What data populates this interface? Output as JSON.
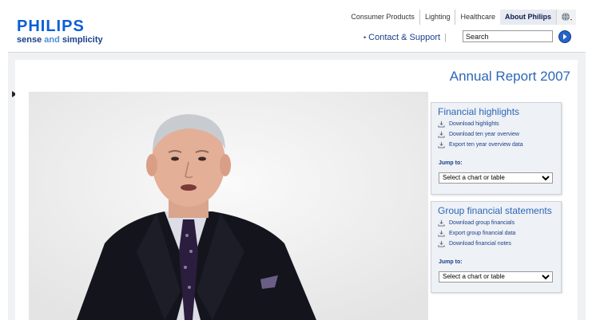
{
  "brand": {
    "logo": "PHILIPS",
    "tagline_a": "sense ",
    "tagline_and": "and",
    "tagline_b": " simplicity"
  },
  "topnav": {
    "tabs": [
      "Consumer Products",
      "Lighting",
      "Healthcare",
      "About Philips"
    ],
    "active": "About Philips"
  },
  "contact": {
    "label": "Contact & Support"
  },
  "search": {
    "value": "Search"
  },
  "main": {
    "title": "Annual Report 2007"
  },
  "financial_highlights": {
    "heading": "Financial highlights",
    "links": [
      "Download highlights",
      "Download ten year overview",
      "Export ten year overview data"
    ],
    "jump_label": "Jump to:",
    "select_value": "Select a chart or table"
  },
  "group_statements": {
    "heading": "Group financial statements",
    "links": [
      "Download group financials",
      "Export group financial data",
      "Download financial notes"
    ],
    "jump_label": "Jump to:",
    "select_value": "Select a chart or table"
  },
  "colors": {
    "accent": "#2d67b8",
    "brand_blue": "#0b5ed7",
    "panel_bg": "#f0f1f2"
  },
  "icons": {
    "download": "download-icon",
    "globe": "globe-icon",
    "search_go": "arrow-right-circle-icon"
  }
}
